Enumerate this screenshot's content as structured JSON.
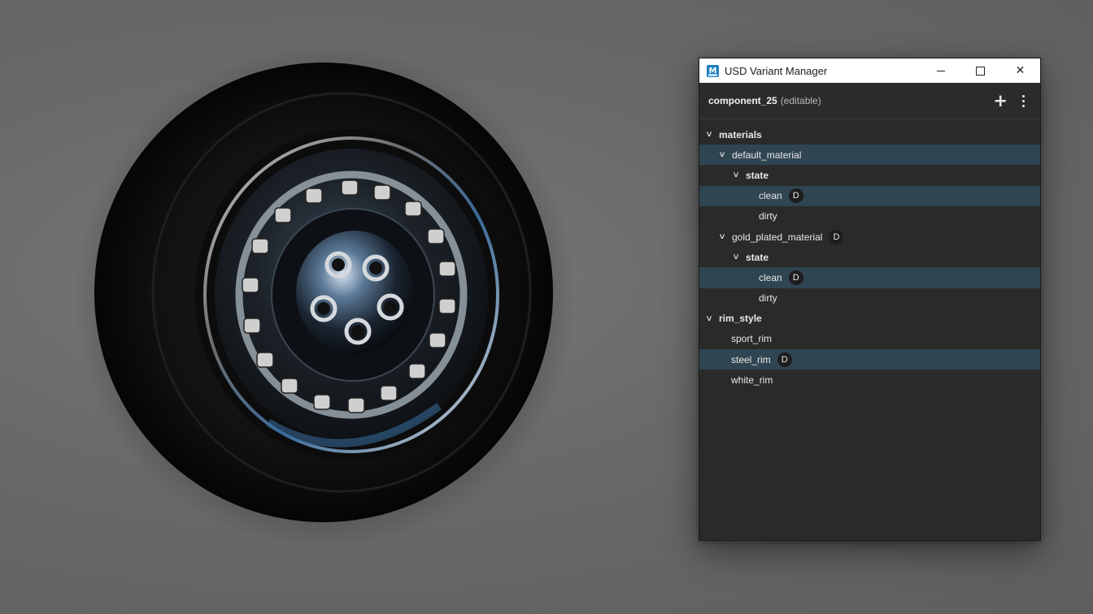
{
  "window": {
    "title": "USD Variant Manager",
    "controls": {
      "minimize": "—",
      "maximize": "□",
      "close": "✕"
    }
  },
  "header": {
    "title": "component_25",
    "subtitle": "(editable)",
    "add_icon": "plus-icon",
    "menu_icon": "kebab-icon"
  },
  "tree": {
    "materials": "materials",
    "default_material": "default_material",
    "state_1": "state",
    "clean_1": "clean",
    "dirty_1": "dirty",
    "gold_plated_material": "gold_plated_material",
    "state_2": "state",
    "clean_2": "clean",
    "dirty_2": "dirty",
    "rim_style": "rim_style",
    "sport_rim": "sport_rim",
    "steel_rim": "steel_rim",
    "white_rim": "white_rim"
  },
  "badges": {
    "default": "D"
  },
  "colors": {
    "selected_row": "#2f4552",
    "panel_bg": "#2a2a2a",
    "titlebar_bg": "#ffffff",
    "viewport_bg": "#6c6c6c"
  }
}
